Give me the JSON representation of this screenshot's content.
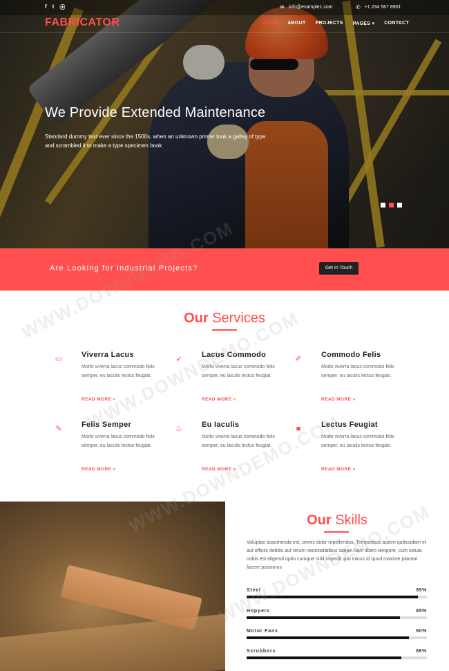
{
  "topbar": {
    "social": [
      {
        "icon": "facebook-icon",
        "glyph": "f"
      },
      {
        "icon": "twitter-icon",
        "glyph": "t"
      },
      {
        "icon": "rss-icon",
        "glyph": "⦿"
      }
    ],
    "email": "info@example1.com",
    "phone": "+1 234 567 8901"
  },
  "brand": "FABRICATOR",
  "nav": {
    "items": [
      {
        "label": "HOME",
        "active": true
      },
      {
        "label": "ABOUT",
        "active": false
      },
      {
        "label": "PROJECTS",
        "active": false
      },
      {
        "label": "PAGES ▾",
        "active": false
      },
      {
        "label": "CONTACT",
        "active": false
      }
    ]
  },
  "hero": {
    "title": "We Provide Extended Maintenance",
    "text": "Standard dummy text ever since the 1500s, when an unknown printer took a galley of type and scrambled it to make a type specimen book",
    "slides": 3,
    "active_slide": 2
  },
  "cta": {
    "text": "Are Looking for Industrial Projects?",
    "button": "Get In Touch"
  },
  "services": {
    "title_bold": "Our",
    "title_light": "Services",
    "items": [
      {
        "icon": "map-icon",
        "glyph": "🗺",
        "title": "Viverra Lacus",
        "text": "Morbi viverra lacus commodo felis semper, eu iaculis lectus feugiat.",
        "link": "READ MORE »"
      },
      {
        "icon": "rocket-icon",
        "glyph": "🚀",
        "title": "Lacus Commodo",
        "text": "Morbi viverra lacus commodo felis semper, eu iaculis lectus feugiat.",
        "link": "READ MORE »"
      },
      {
        "icon": "paint-brush-icon",
        "glyph": "🖌",
        "title": "Commodo Felis",
        "text": "Morbi viverra lacus commodo felis semper, eu iaculis lectus feugiat.",
        "link": "READ MORE »"
      },
      {
        "icon": "pencil-icon",
        "glyph": "✎",
        "title": "Felis Semper",
        "text": "Morbi viverra lacus commodo felis semper, eu iaculis lectus feugiat.",
        "link": "READ MORE »"
      },
      {
        "icon": "fire-icon",
        "glyph": "🔥",
        "title": "Eu Iaculis",
        "text": "Morbi viverra lacus commodo felis semper, eu iaculis lectus feugiat.",
        "link": "READ MORE »"
      },
      {
        "icon": "video-camera-icon",
        "glyph": "🎥",
        "title": "Lectus Feugiat",
        "text": "Morbi viverra lacus commodo felis semper, eu iaculis lectus feugiat.",
        "link": "READ MORE »"
      }
    ]
  },
  "skills": {
    "title_bold": "Our",
    "title_light": "Skills",
    "description": "Voluptas assumenda est, omnis dolor repellendus. Temporibus autem quibusdam et aut officiis debitis aut rerum necessitatibus saepe.Nam libero tempore, cum soluta nobis est eligendi optio cumque nihil impedit quo minus id quod maxime placeat facere possimus",
    "items": [
      {
        "name": "Steel",
        "pct_label": "95%",
        "value": 95
      },
      {
        "name": "Hoppers",
        "pct_label": "85%",
        "value": 85
      },
      {
        "name": "Motor Fans",
        "pct_label": "90%",
        "value": 90
      },
      {
        "name": "Scrubbors",
        "pct_label": "86%",
        "value": 86
      }
    ]
  },
  "watermark": "WWW.DOWNDEMO.COM",
  "colors": {
    "accent": "#ff4e4e",
    "dark": "#222222"
  }
}
